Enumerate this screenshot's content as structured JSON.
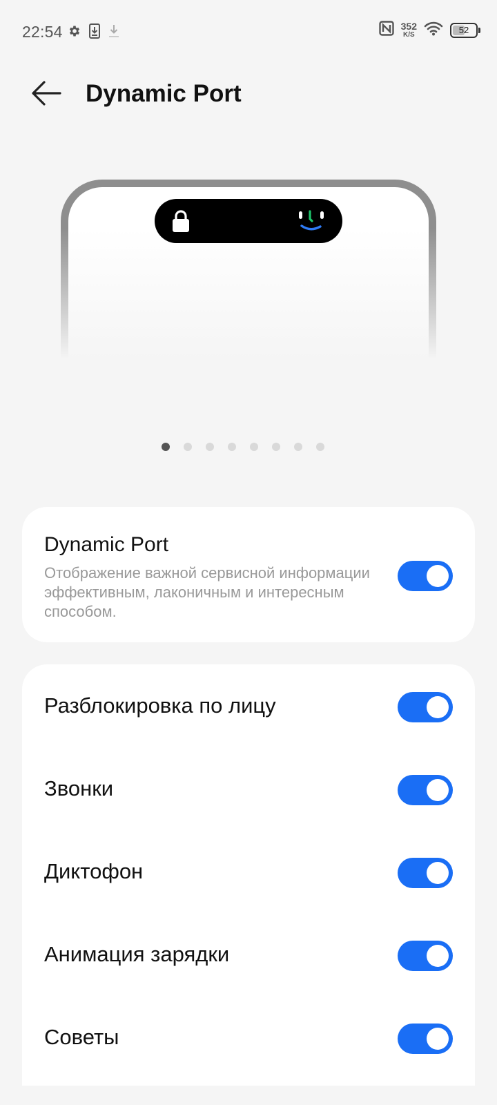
{
  "status_bar": {
    "time": "22:54",
    "left_icons": [
      "gear-icon",
      "download-box-icon",
      "download-icon"
    ],
    "net_speed_value": "352",
    "net_speed_unit": "K/S",
    "battery_level": "52",
    "battery_percent": 52
  },
  "header": {
    "back_icon": "arrow-left-icon",
    "title": "Dynamic Port"
  },
  "preview": {
    "left_icon": "lock-icon",
    "right_icon": "face-unlock-icon",
    "pages_total": 8,
    "active_page": 1
  },
  "main_setting": {
    "title": "Dynamic Port",
    "description": "Отображение важной сервисной информации эффективным, лаконичным и интересным способом.",
    "enabled": true
  },
  "features": [
    {
      "label": "Разблокировка по лицу",
      "enabled": true
    },
    {
      "label": "Звонки",
      "enabled": true
    },
    {
      "label": "Диктофон",
      "enabled": true
    },
    {
      "label": "Анимация зарядки",
      "enabled": true
    },
    {
      "label": "Советы",
      "enabled": true
    }
  ],
  "colors": {
    "accent": "#1a6ef5",
    "background": "#f5f5f5",
    "card": "#ffffff"
  }
}
